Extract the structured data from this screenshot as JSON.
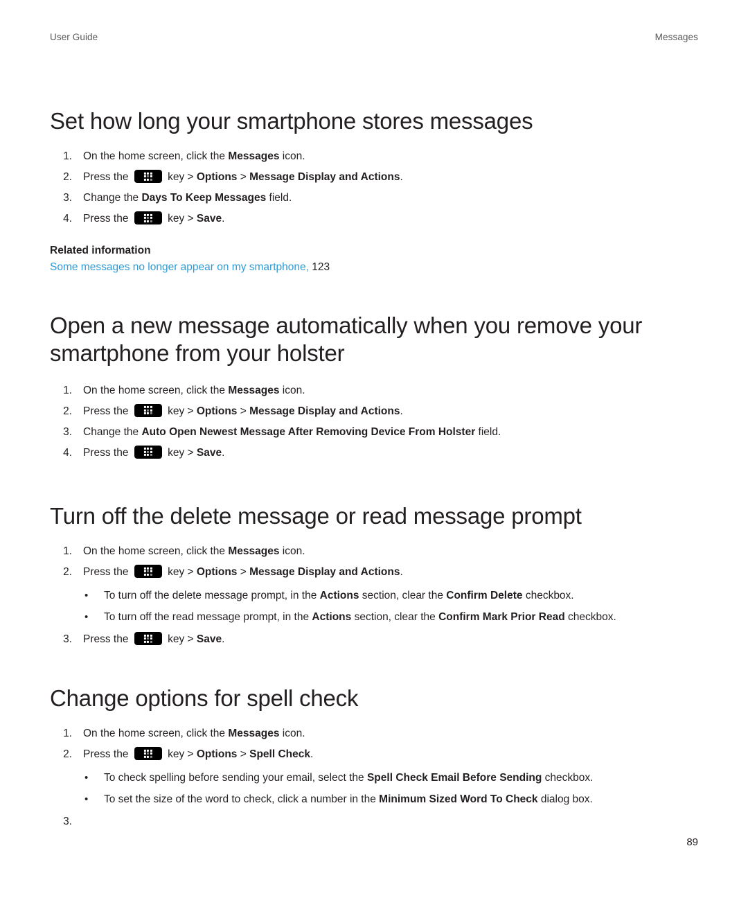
{
  "header": {
    "left": "User Guide",
    "right": "Messages"
  },
  "folio": "89",
  "menu_key_icon": "blackberry-menu-key-icon",
  "sections": [
    {
      "heading": "Set how long your smartphone stores messages",
      "steps": [
        {
          "num": "1.",
          "parts": [
            {
              "t": "On the home screen, click the ",
              "b": false
            },
            {
              "t": "Messages",
              "b": true
            },
            {
              "t": " icon.",
              "b": false
            }
          ]
        },
        {
          "num": "2.",
          "parts": [
            {
              "t": "Press the ",
              "b": false
            },
            {
              "t": "__KEY__",
              "b": false
            },
            {
              "t": " key > ",
              "b": false
            },
            {
              "t": "Options",
              "b": true
            },
            {
              "t": " > ",
              "b": false
            },
            {
              "t": "Message Display and Actions",
              "b": true
            },
            {
              "t": ".",
              "b": false
            }
          ]
        },
        {
          "num": "3.",
          "parts": [
            {
              "t": "Change the ",
              "b": false
            },
            {
              "t": "Days To Keep Messages",
              "b": true
            },
            {
              "t": " field.",
              "b": false
            }
          ]
        },
        {
          "num": "4.",
          "parts": [
            {
              "t": "Press the ",
              "b": false
            },
            {
              "t": "__KEY__",
              "b": false
            },
            {
              "t": " key > ",
              "b": false
            },
            {
              "t": "Save",
              "b": true
            },
            {
              "t": ".",
              "b": false
            }
          ]
        }
      ],
      "related": {
        "title": "Related information",
        "link_text": "Some messages no longer appear on my smartphone,",
        "page": "123"
      }
    },
    {
      "heading": "Open a new message automatically when you remove your smartphone from your holster",
      "steps": [
        {
          "num": "1.",
          "parts": [
            {
              "t": "On the home screen, click the ",
              "b": false
            },
            {
              "t": "Messages",
              "b": true
            },
            {
              "t": " icon.",
              "b": false
            }
          ]
        },
        {
          "num": "2.",
          "parts": [
            {
              "t": "Press the ",
              "b": false
            },
            {
              "t": "__KEY__",
              "b": false
            },
            {
              "t": " key > ",
              "b": false
            },
            {
              "t": "Options",
              "b": true
            },
            {
              "t": " > ",
              "b": false
            },
            {
              "t": "Message Display and Actions",
              "b": true
            },
            {
              "t": ".",
              "b": false
            }
          ]
        },
        {
          "num": "3.",
          "parts": [
            {
              "t": "Change the ",
              "b": false
            },
            {
              "t": "Auto Open Newest Message After Removing Device From Holster",
              "b": true
            },
            {
              "t": " field.",
              "b": false
            }
          ]
        },
        {
          "num": "4.",
          "parts": [
            {
              "t": "Press the ",
              "b": false
            },
            {
              "t": "__KEY__",
              "b": false
            },
            {
              "t": " key > ",
              "b": false
            },
            {
              "t": "Save",
              "b": true
            },
            {
              "t": ".",
              "b": false
            }
          ]
        }
      ]
    },
    {
      "heading": "Turn off the delete message or read message prompt",
      "steps": [
        {
          "num": "1.",
          "parts": [
            {
              "t": "On the home screen, click the ",
              "b": false
            },
            {
              "t": "Messages",
              "b": true
            },
            {
              "t": " icon.",
              "b": false
            }
          ]
        },
        {
          "num": "2.",
          "parts": [
            {
              "t": "Press the ",
              "b": false
            },
            {
              "t": "__KEY__",
              "b": false
            },
            {
              "t": " key > ",
              "b": false
            },
            {
              "t": "Options",
              "b": true
            },
            {
              "t": " > ",
              "b": false
            },
            {
              "t": "Message Display and Actions",
              "b": true
            },
            {
              "t": ".",
              "b": false
            }
          ]
        }
      ],
      "bullets": [
        [
          {
            "t": "To turn off the delete message prompt, in the ",
            "b": false
          },
          {
            "t": "Actions",
            "b": true
          },
          {
            "t": " section, clear the ",
            "b": false
          },
          {
            "t": "Confirm Delete",
            "b": true
          },
          {
            "t": " checkbox.",
            "b": false
          }
        ],
        [
          {
            "t": "To turn off the read message prompt, in the ",
            "b": false
          },
          {
            "t": "Actions",
            "b": true
          },
          {
            "t": " section, clear the ",
            "b": false
          },
          {
            "t": "Confirm Mark Prior Read",
            "b": true
          },
          {
            "t": " checkbox.",
            "b": false
          }
        ]
      ],
      "steps_after": [
        {
          "num": "3.",
          "parts": [
            {
              "t": "Press the ",
              "b": false
            },
            {
              "t": "__KEY__",
              "b": false
            },
            {
              "t": " key > ",
              "b": false
            },
            {
              "t": "Save",
              "b": true
            },
            {
              "t": ".",
              "b": false
            }
          ]
        }
      ]
    },
    {
      "heading": "Change options for spell check",
      "steps": [
        {
          "num": "1.",
          "parts": [
            {
              "t": "On the home screen, click the ",
              "b": false
            },
            {
              "t": "Messages",
              "b": true
            },
            {
              "t": " icon.",
              "b": false
            }
          ]
        },
        {
          "num": "2.",
          "parts": [
            {
              "t": "Press the ",
              "b": false
            },
            {
              "t": "__KEY__",
              "b": false
            },
            {
              "t": " key > ",
              "b": false
            },
            {
              "t": "Options",
              "b": true
            },
            {
              "t": " > ",
              "b": false
            },
            {
              "t": "Spell Check",
              "b": true
            },
            {
              "t": ".",
              "b": false
            }
          ]
        }
      ],
      "bullets": [
        [
          {
            "t": "To check spelling before sending your email, select the ",
            "b": false
          },
          {
            "t": "Spell Check Email Before Sending",
            "b": true
          },
          {
            "t": " checkbox.",
            "b": false
          }
        ],
        [
          {
            "t": "To set the size of the word to check, click a number in the ",
            "b": false
          },
          {
            "t": "Minimum Sized Word To Check",
            "b": true
          },
          {
            "t": " dialog box.",
            "b": false
          }
        ]
      ],
      "steps_after": [
        {
          "num": "3.",
          "parts": []
        }
      ]
    }
  ]
}
